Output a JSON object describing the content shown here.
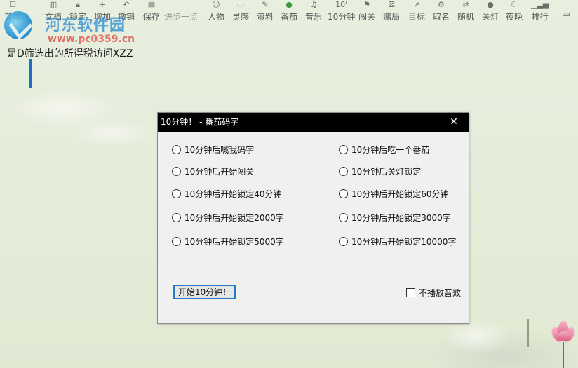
{
  "toolbar": {
    "items": [
      {
        "name": "menu",
        "icon": "checkbox-icon",
        "label": "菜单"
      },
      {
        "name": "file",
        "icon": "book-icon",
        "label": "文档"
      },
      {
        "name": "lock",
        "icon": "lock-icon",
        "label": "锁定"
      },
      {
        "name": "add",
        "icon": "plus-icon",
        "label": "增加"
      },
      {
        "name": "undo",
        "icon": "undo-icon",
        "label": "撤销"
      },
      {
        "name": "save",
        "icon": "save-icon",
        "label": "保存"
      },
      {
        "name": "progress",
        "icon": "",
        "label": "进步一点"
      },
      {
        "name": "person",
        "icon": "person-icon",
        "label": "人物"
      },
      {
        "name": "inspiration",
        "icon": "note-icon",
        "label": "灵感"
      },
      {
        "name": "material",
        "icon": "pen-icon",
        "label": "资料"
      },
      {
        "name": "tomato",
        "icon": "tomato-icon",
        "label": "番茄"
      },
      {
        "name": "music",
        "icon": "music-icon",
        "label": "音乐"
      },
      {
        "name": "ten-min",
        "icon": "ten-icon",
        "label": "10分钟"
      },
      {
        "name": "challenge",
        "icon": "flag-icon",
        "label": "闯关"
      },
      {
        "name": "bet",
        "icon": "dice-icon",
        "label": "赌局"
      },
      {
        "name": "goal",
        "icon": "target-icon",
        "label": "目标"
      },
      {
        "name": "naming",
        "icon": "tag-icon",
        "label": "取名"
      },
      {
        "name": "random",
        "icon": "shuffle-icon",
        "label": "随机"
      },
      {
        "name": "light-off",
        "icon": "bulb-icon",
        "label": "关灯"
      },
      {
        "name": "night",
        "icon": "moon-icon",
        "label": "夜晚"
      },
      {
        "name": "rank",
        "icon": "bars-icon",
        "label": "排行"
      }
    ]
  },
  "watermark": {
    "title": "河东软件园",
    "url": "www.pc0359.cn"
  },
  "document": {
    "text": "是D筛选出的所得税访问XZZ"
  },
  "dialog": {
    "title": "10分钟！ - 番茄码字",
    "options_left": [
      "10分钟后喊我码字",
      "10分钟后开始闯关",
      "10分钟后开始锁定40分钟",
      "10分钟后开始锁定2000字",
      "10分钟后开始锁定5000字"
    ],
    "options_right": [
      "10分钟后吃一个番茄",
      "10分钟后关灯锁定",
      "10分钟后开始锁定60分钟",
      "10分钟后开始锁定3000字",
      "10分钟后开始锁定10000字"
    ],
    "start_button": "开始10分钟！",
    "mute_label": "不播放音效"
  },
  "colors": {
    "accent": "#2a79c9",
    "title_bar": "#000000",
    "background": "#e4ebd7"
  }
}
